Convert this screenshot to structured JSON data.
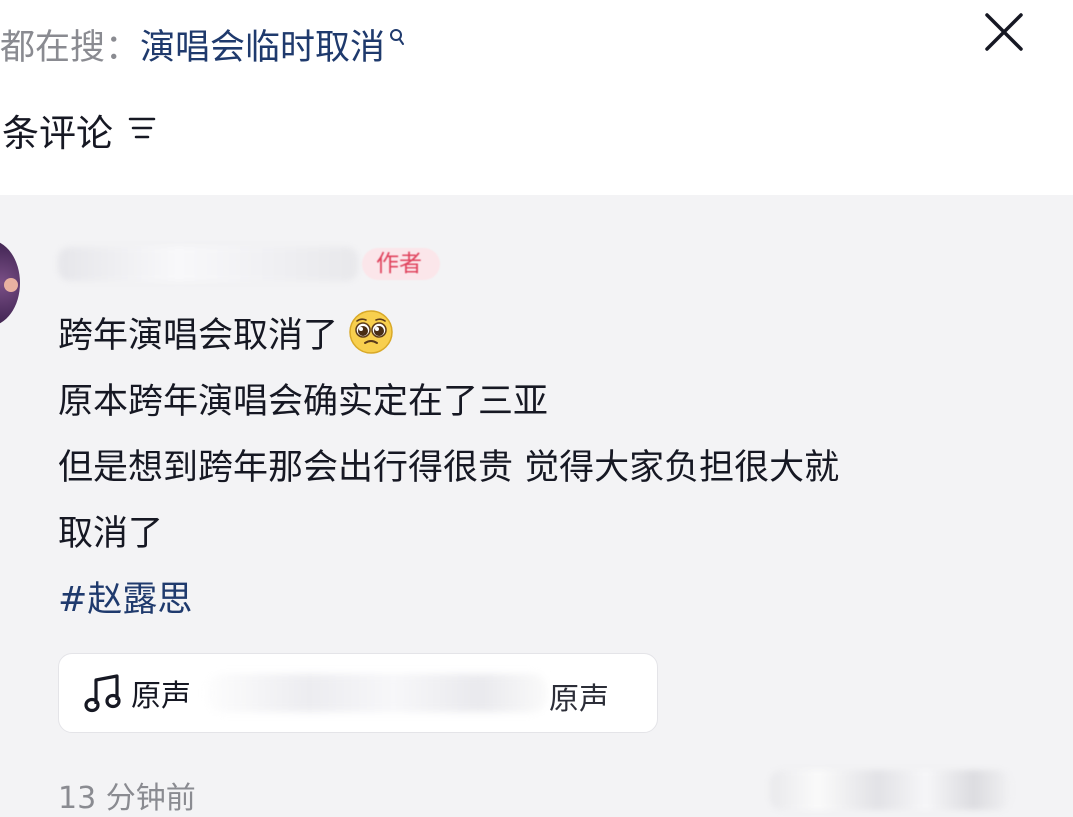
{
  "search": {
    "prefix": "都在搜：",
    "query": "演唱会临时取消"
  },
  "comments_header": {
    "count_label": "条评论"
  },
  "comment": {
    "author_badge": "作者",
    "lines": [
      "跨年演唱会取消了",
      "原本跨年演唱会确实定在了三亚",
      "但是想到跨年那会出行得很贵 觉得大家负担很大就",
      "取消了"
    ],
    "hashtag": "#赵露思",
    "music_label": "原声",
    "music_label_end": "原声",
    "timestamp": "13 分钟前"
  },
  "icons": {
    "search": "search-icon",
    "close": "close-icon",
    "sort": "sort-icon",
    "emoji": "pleading-face-emoji",
    "music": "music-note-icon"
  },
  "colors": {
    "link": "#1f3a6d",
    "badge_text": "#e0435d",
    "badge_bg": "#fbe6ea",
    "muted": "#8a8b91"
  }
}
